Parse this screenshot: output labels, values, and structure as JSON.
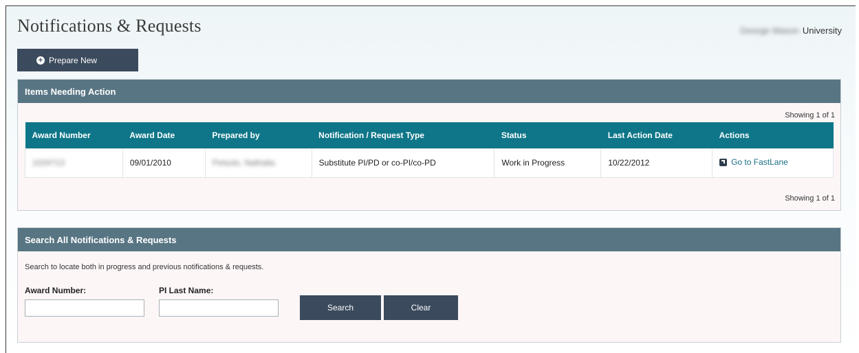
{
  "page": {
    "title": "Notifications & Requests",
    "institution_redacted": "George Mason",
    "institution_suffix": "University"
  },
  "toolbar": {
    "prepare_new_label": "Prepare New",
    "prepare_new_icon": "plus-circle-icon"
  },
  "items_panel": {
    "title": "Items Needing Action",
    "showing_top": "Showing 1 of 1",
    "showing_bottom": "Showing 1 of 1",
    "columns": [
      "Award Number",
      "Award Date",
      "Prepared by",
      "Notification / Request Type",
      "Status",
      "Last Action Date",
      "Actions"
    ],
    "rows": [
      {
        "award_number": "1024713",
        "award_date": "09/01/2010",
        "prepared_by": "Petsolo, Nathalia",
        "type": "Substitute PI/PD or co-PI/co-PD",
        "status": "Work in Progress",
        "last_action_date": "10/22/2012",
        "action_label": "Go to FastLane",
        "action_icon": "external-link-icon"
      }
    ]
  },
  "search_panel": {
    "title": "Search All Notifications & Requests",
    "description": "Search to locate both in progress and previous notifications & requests.",
    "award_number_label": "Award Number:",
    "award_number_value": "",
    "pi_last_name_label": "PI Last Name:",
    "pi_last_name_value": "",
    "search_label": "Search",
    "clear_label": "Clear"
  },
  "colors": {
    "dark_button": "#3b4a5d",
    "panel_header": "#587583",
    "table_header": "#0e7688",
    "link": "#1a6f86",
    "panel_bg": "#fcf6f7"
  }
}
